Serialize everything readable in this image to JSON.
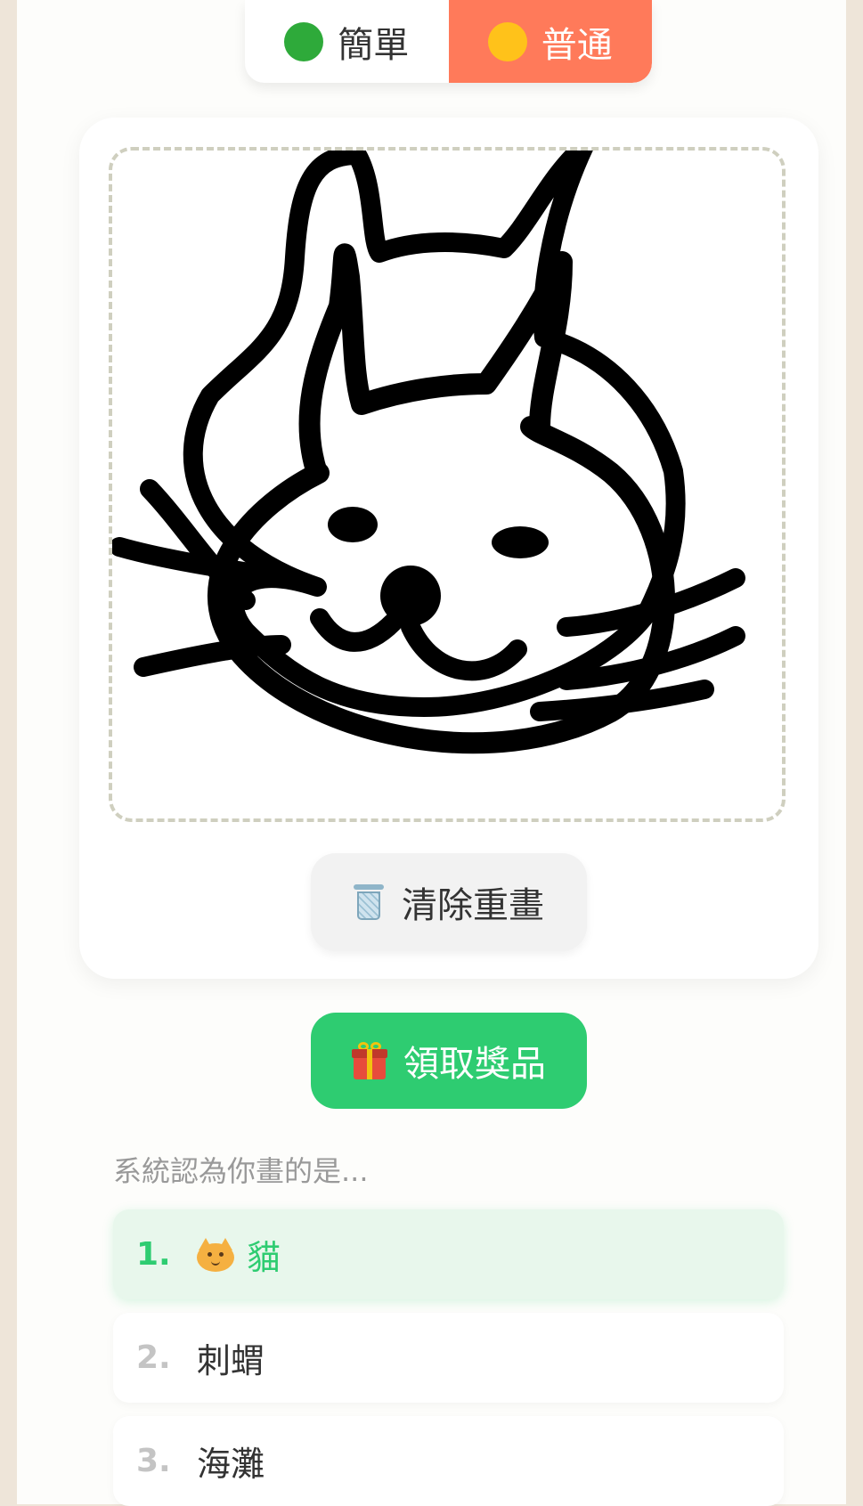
{
  "level_toggle": {
    "easy": {
      "label": "簡單",
      "dot_color": "#2eaa3a"
    },
    "normal": {
      "label": "普通",
      "dot_color": "#ffc21a",
      "selected": true
    }
  },
  "canvas": {
    "clear_label": "清除重畫"
  },
  "claim_label": "領取獎品",
  "results": {
    "prompt": "系統認為你畫的是...",
    "items": [
      {
        "rank": "1.",
        "label": "貓",
        "icon": "cat-face-icon",
        "highlighted": true
      },
      {
        "rank": "2.",
        "label": "刺蝟"
      },
      {
        "rank": "3.",
        "label": "海灘"
      }
    ]
  },
  "colors": {
    "accent_orange": "#ff7a5a",
    "accent_green": "#2ecc71",
    "background": "#eee5d9"
  }
}
